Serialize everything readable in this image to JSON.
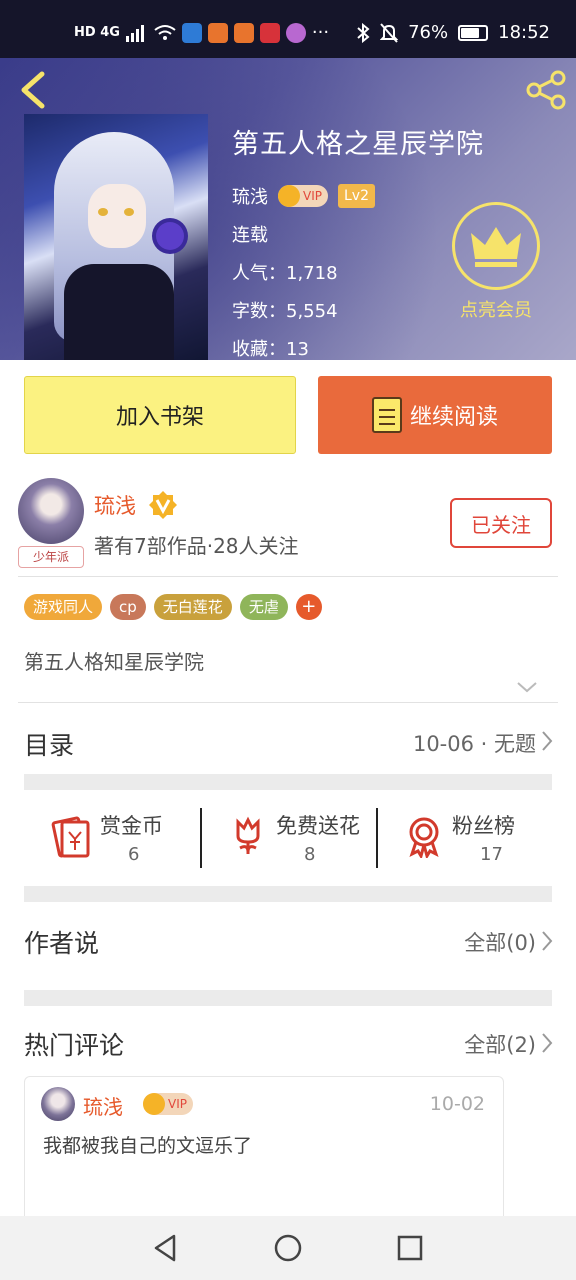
{
  "status_bar": {
    "network": "HD 4G",
    "battery": "76%",
    "battery_level": 0.76,
    "time": "18:52",
    "more": "···"
  },
  "book": {
    "title": "第五人格之星辰学院",
    "author": "琉浅",
    "vip": "VIP",
    "level": "Lv2",
    "status": "连载",
    "popularity": "人气：1,718",
    "words": "字数：5,554",
    "favorites": "收藏：13"
  },
  "member": {
    "label": "点亮会员"
  },
  "actions": {
    "add_shelf": "加入书架",
    "continue_read": "继续阅读"
  },
  "author_block": {
    "badge": "少年派",
    "name": "琉浅",
    "meta": "著有7部作品·28人关注",
    "follow": "已关注"
  },
  "tags": [
    {
      "label": "游戏同人",
      "color": "#f0a83a"
    },
    {
      "label": "cp",
      "color": "#c8785a"
    },
    {
      "label": "无白莲花",
      "color": "#c9a13c"
    },
    {
      "label": "无虐",
      "color": "#8fb55a"
    }
  ],
  "tag_add": "+",
  "description": "第五人格知星辰学院",
  "catalog": {
    "title": "目录",
    "latest": "10-06 · 无题"
  },
  "rewards": [
    {
      "label": "赏金币",
      "value": "6",
      "icon": "red-envelope-icon"
    },
    {
      "label": "免费送花",
      "value": "8",
      "icon": "flower-icon"
    },
    {
      "label": "粉丝榜",
      "value": "17",
      "icon": "medal-icon"
    }
  ],
  "author_says": {
    "title": "作者说",
    "all": "全部(0)"
  },
  "hot_comments": {
    "title": "热门评论",
    "all": "全部(2)"
  },
  "comment": {
    "name": "琉浅",
    "vip": "VIP",
    "date": "10-02",
    "text": "我都被我自己的文逗乐了"
  },
  "colors": {
    "accent_orange": "#e96a3c",
    "shelf_yellow": "#fbf281",
    "member_yellow": "#f6e36a",
    "follow_red": "#e0463a"
  }
}
